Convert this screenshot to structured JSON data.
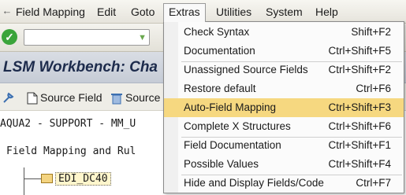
{
  "menubar": {
    "items": [
      "Field Mapping",
      "Edit",
      "Goto",
      "Extras",
      "Utilities",
      "System",
      "Help"
    ]
  },
  "titlebar": {
    "title": "LSM Workbench: Cha"
  },
  "appbar": {
    "source_field_label": "Source Field",
    "source_field_label_2": "Source F"
  },
  "content": {
    "project_line": "AQUA2 - SUPPORT - MM_U",
    "heading_line": "Field Mapping and Rul",
    "tree_node": "EDI_DC40"
  },
  "extras_menu": {
    "items": [
      {
        "label": "Check Syntax",
        "shortcut": "Shift+F2"
      },
      {
        "label": "Documentation",
        "shortcut": "Ctrl+Shift+F5"
      },
      {
        "label": "Unassigned Source Fields",
        "shortcut": "Ctrl+Shift+F2"
      },
      {
        "label": "Restore default",
        "shortcut": "Ctrl+F6"
      },
      {
        "label": "Auto-Field Mapping",
        "shortcut": "Ctrl+Shift+F3"
      },
      {
        "label": "Complete X Structures",
        "shortcut": "Ctrl+Shift+F6"
      },
      {
        "label": "Field Documentation",
        "shortcut": "Ctrl+Shift+F1"
      },
      {
        "label": "Possible Values",
        "shortcut": "Ctrl+Shift+F4"
      },
      {
        "label": "Hide and Display Fields/Code",
        "shortcut": "Ctrl+F7"
      }
    ],
    "selected_index": 4
  },
  "colors": {
    "selected_item": "#f6d880",
    "title_text": "#1d2b4c",
    "ok_icon": "#3aa43a"
  }
}
